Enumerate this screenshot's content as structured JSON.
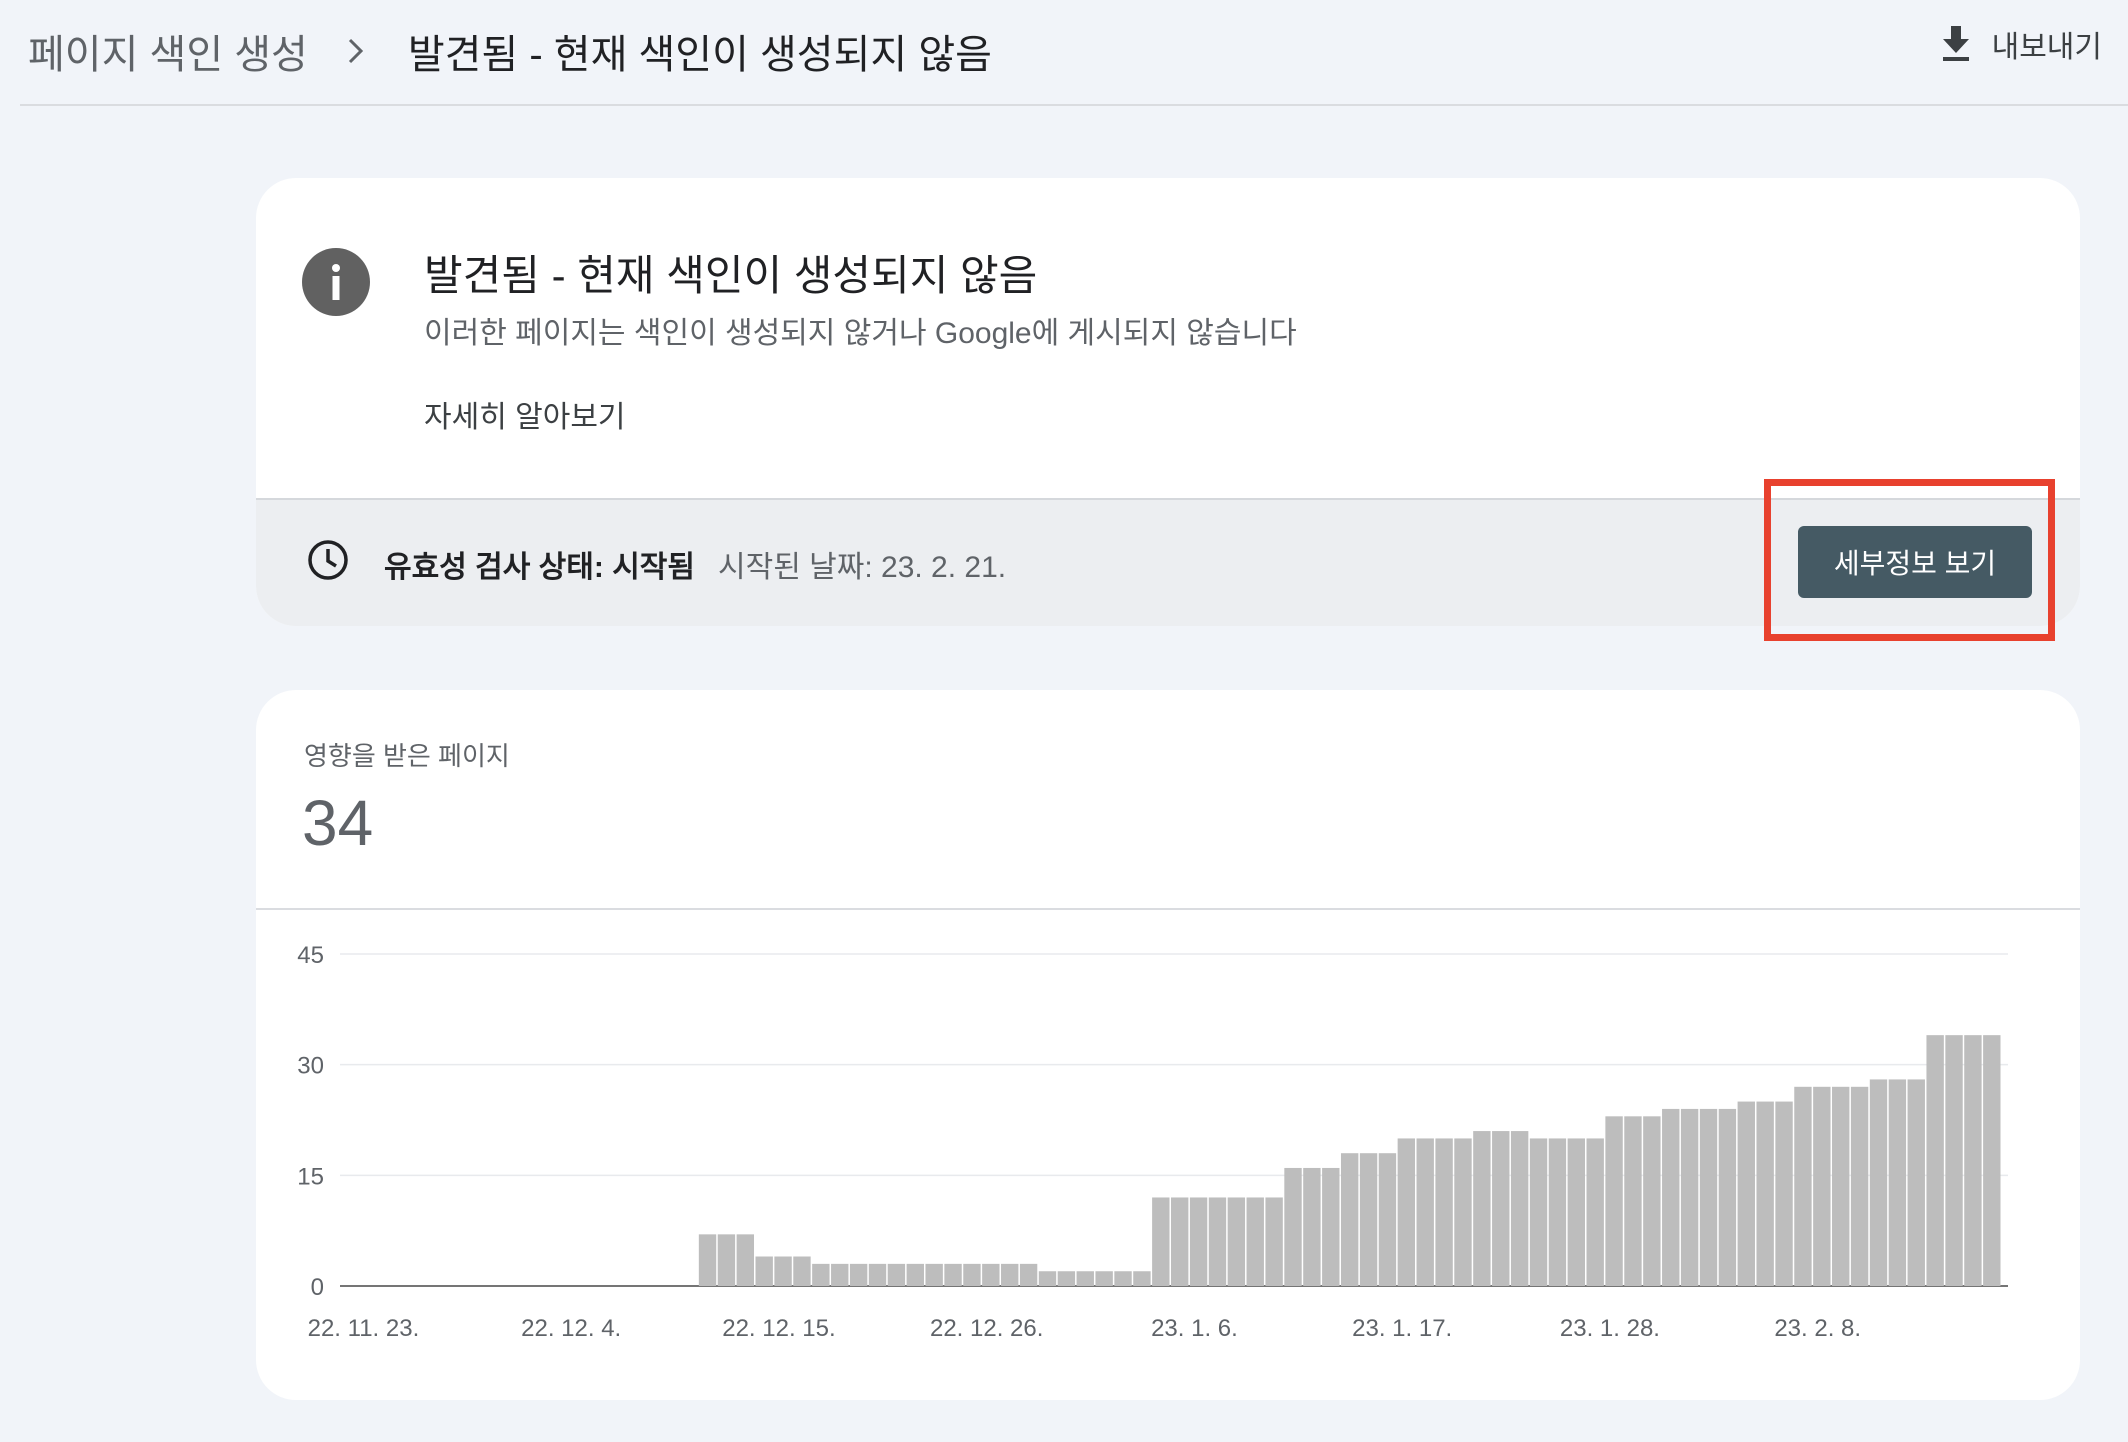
{
  "header": {
    "breadcrumb_parent": "페이지 색인 생성",
    "breadcrumb_current": "발견됨 - 현재 색인이 생성되지 않음",
    "export_label": "내보내기"
  },
  "issue_card": {
    "title": "발견됨 - 현재 색인이 생성되지 않음",
    "description": "이러한 페이지는 색인이 생성되지 않거나 Google에 게시되지 않습니다",
    "learn_more": "자세히 알아보기",
    "validation_status": "유효성 검사 상태: 시작됨",
    "validation_started": "시작된 날짜: 23. 2. 21.",
    "details_button": "세부정보 보기",
    "highlight_color": "#e8412e"
  },
  "affected_card": {
    "label": "영향을 받은 페이지",
    "value": "34"
  },
  "chart_data": {
    "type": "bar",
    "title": "",
    "xlabel": "",
    "ylabel": "",
    "ylim": [
      0,
      45
    ],
    "yticks": [
      0,
      15,
      30,
      45
    ],
    "xtick_labels": [
      "22. 11. 23.",
      "22. 12. 4.",
      "22. 12. 15.",
      "22. 12. 26.",
      "23. 1. 6.",
      "23. 1. 17.",
      "23. 1. 28.",
      "23. 2. 8."
    ],
    "bar_color": "#bdbdbd",
    "grid": true,
    "values": [
      0,
      0,
      0,
      0,
      0,
      0,
      0,
      0,
      0,
      0,
      0,
      0,
      0,
      0,
      0,
      0,
      0,
      0,
      0,
      7,
      7,
      7,
      4,
      4,
      4,
      3,
      3,
      3,
      3,
      3,
      3,
      3,
      3,
      3,
      3,
      3,
      3,
      2,
      2,
      2,
      2,
      2,
      2,
      12,
      12,
      12,
      12,
      12,
      12,
      12,
      16,
      16,
      16,
      18,
      18,
      18,
      20,
      20,
      20,
      20,
      21,
      21,
      21,
      20,
      20,
      20,
      20,
      23,
      23,
      23,
      24,
      24,
      24,
      24,
      25,
      25,
      25,
      27,
      27,
      27,
      27,
      28,
      28,
      28,
      34,
      34,
      34,
      34
    ]
  }
}
